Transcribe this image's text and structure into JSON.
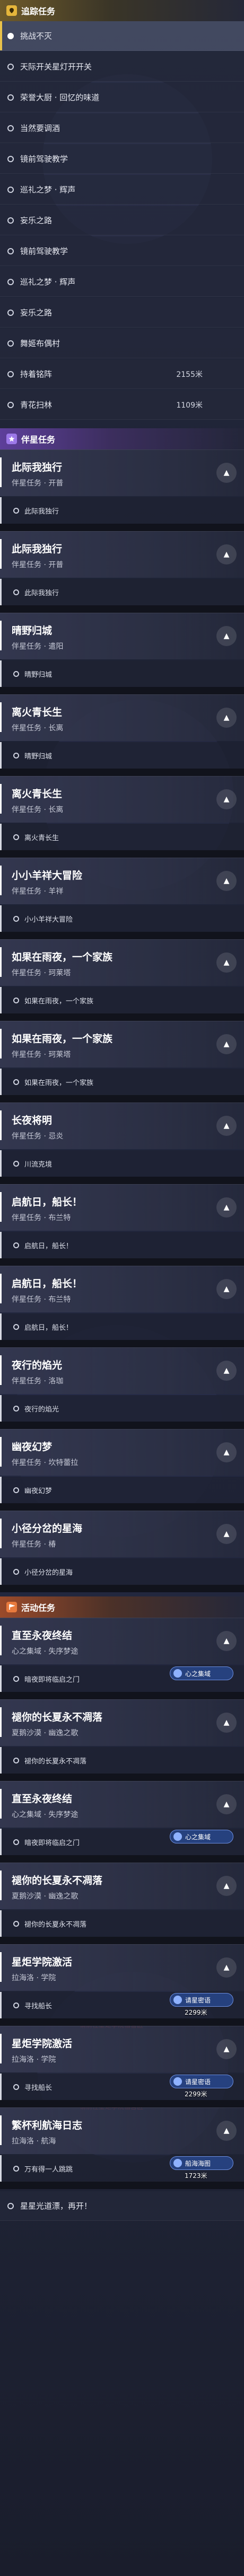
{
  "header_tracking": {
    "title": "追踪任务"
  },
  "tracking_items": [
    {
      "label": "挑战不灭"
    },
    {
      "label": "天际开关星灯开开关"
    },
    {
      "label": "荣誉大厨 · 回忆的味道"
    },
    {
      "label": "当然要调酒"
    },
    {
      "label": "镜前驾驶教学"
    },
    {
      "label": "巡礼之梦 · 辉声"
    },
    {
      "label": "妄乐之路"
    },
    {
      "label": "镜前驾驶教学"
    },
    {
      "label": "巡礼之梦 · 辉声"
    },
    {
      "label": "妄乐之路"
    },
    {
      "label": "舞姬布偶村"
    },
    {
      "label": "持着铭阵",
      "distance": "2155米"
    },
    {
      "label": "青花扫林",
      "distance": "1109米"
    }
  ],
  "header_companion": {
    "title": "伴星任务"
  },
  "companion_quests": [
    {
      "title": "此际我独行",
      "subtitle": "伴星任务 · 开普",
      "sub": "此际我独行"
    },
    {
      "title": "此际我独行",
      "subtitle": "伴星任务 · 开普",
      "sub": "此际我独行"
    },
    {
      "title": "晴野归城",
      "subtitle": "伴星任务 · 遣阳",
      "sub": "晴野归城"
    },
    {
      "title": "离火青长生",
      "subtitle": "伴星任务 · 长离",
      "sub": "晴野归城"
    },
    {
      "title": "离火青长生",
      "subtitle": "伴星任务 · 长离",
      "sub": "离火青长生"
    },
    {
      "title": "小小羊祥大冒险",
      "subtitle": "伴星任务 · 羊祥",
      "sub": "小小羊祥大冒险"
    },
    {
      "title": "如果在雨夜，一个家族",
      "subtitle": "伴星任务 · 珂莱塔",
      "sub": "如果在雨夜，一个家族"
    },
    {
      "title": "如果在雨夜，一个家族",
      "subtitle": "伴星任务 · 珂莱塔",
      "sub": "如果在雨夜，一个家族"
    },
    {
      "title": "长夜将明",
      "subtitle": "伴星任务 · 忌炎",
      "sub": "川流克境"
    },
    {
      "title": "启航日，船长！",
      "subtitle": "伴星任务 · 布兰特",
      "sub": "启航日，船长！"
    },
    {
      "title": "启航日，船长！",
      "subtitle": "伴星任务 · 布兰特",
      "sub": "启航日，船长！"
    },
    {
      "title": "夜行的焰光",
      "subtitle": "伴星任务 · 洛珈",
      "sub": "夜行的焰光"
    },
    {
      "title": "幽夜幻梦",
      "subtitle": "伴星任务 · 坎特蕾拉",
      "sub": "幽夜幻梦"
    },
    {
      "title": "小径分岔的星海",
      "subtitle": "伴星任务 · 椿",
      "sub": "小径分岔的星海"
    }
  ],
  "header_activity": {
    "title": "活动任务"
  },
  "activity_quests": [
    {
      "title": "直至永夜终结",
      "subtitle": "心之集域 · 失序梦途",
      "sub": "暗夜即将临启之门",
      "badge": "心之集域"
    },
    {
      "title": "褪你的长夏永不凋落",
      "subtitle": "夏鹅沙漠 · 幽逸之歌",
      "sub": "褪你的长夏永不凋落"
    },
    {
      "title": "直至永夜终结",
      "subtitle": "心之集域 · 失序梦途",
      "sub": "暗夜即将临启之门",
      "badge": "心之集域"
    },
    {
      "title": "褪你的长夏永不凋落",
      "subtitle": "夏鹅沙漠 · 幽逸之歌",
      "sub": "褪你的长夏永不凋落"
    },
    {
      "title": "星炬学院激活",
      "subtitle": "拉海洛 · 学院",
      "sub": "寻找船长",
      "badge": "请星密语",
      "distance": "2299米",
      "note": "请前往星炬学院宿舍区"
    },
    {
      "title": "星炬学院激活",
      "subtitle": "拉海洛 · 学院",
      "sub": "寻找船长",
      "badge": "请星密语",
      "distance": "2299米",
      "note": "请前往星炬学院宿舍区"
    },
    {
      "title": "繁杯利航海日志",
      "subtitle": "拉海洛 · 航海",
      "sub": "万有得一人跳跳",
      "badge": "船海海图",
      "distance": "1723米"
    }
  ],
  "footer_row": {
    "label": "星星光道漂，再开！"
  }
}
